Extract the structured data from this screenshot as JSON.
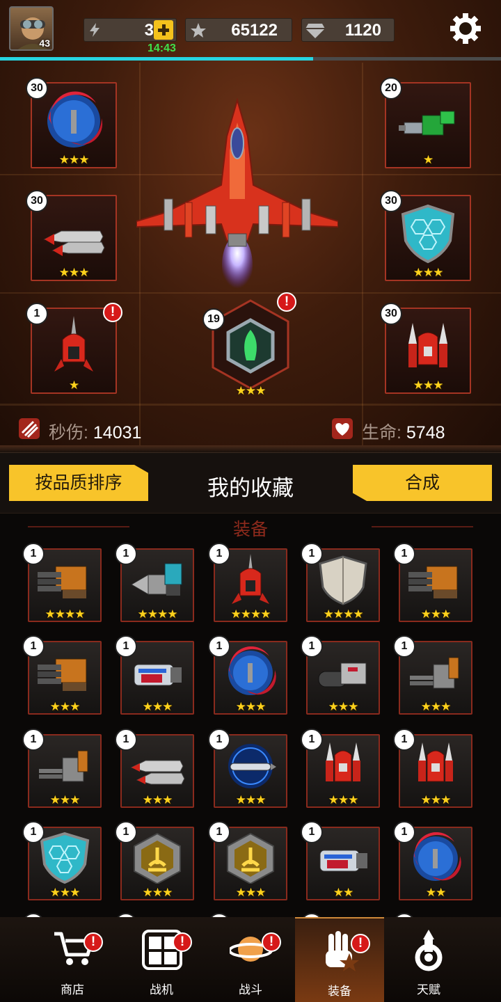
{
  "player": {
    "level": "43"
  },
  "resources": {
    "energy": "3",
    "energy_timer": "14:43",
    "stars": "65122",
    "gems": "1120"
  },
  "xp_progress": 0.625,
  "loadout": {
    "slots": [
      {
        "level": "30",
        "stars": "★★★",
        "item": "crescent-blade"
      },
      {
        "level": "20",
        "stars": "★",
        "item": "green-drill-cannon"
      },
      {
        "level": "30",
        "stars": "★★★",
        "item": "twin-missile-pod"
      },
      {
        "level": "30",
        "stars": "★★★",
        "item": "hex-shield"
      },
      {
        "level": "1",
        "stars": "★",
        "item": "red-drone",
        "alert": "!"
      },
      {
        "level": "30",
        "stars": "★★★",
        "item": "red-twin-drone"
      }
    ],
    "core": {
      "level": "19",
      "stars": "★★★",
      "alert": "!"
    }
  },
  "stats": {
    "dps_label": "秒伤:",
    "dps_value": "14031",
    "hp_label": "生命:",
    "hp_value": "5748"
  },
  "collection": {
    "sort_button": "按品质排序",
    "title": "我的收藏",
    "merge_button": "合成",
    "section": "装备"
  },
  "inventory": [
    {
      "level": "1",
      "stars": "★★★★",
      "item": "gatling"
    },
    {
      "level": "1",
      "stars": "★★★★",
      "item": "drill"
    },
    {
      "level": "1",
      "stars": "★★★★",
      "item": "red-drone"
    },
    {
      "level": "1",
      "stars": "★★★★",
      "item": "steel-shield"
    },
    {
      "level": "1",
      "stars": "★★★",
      "item": "gatling"
    },
    {
      "level": "1",
      "stars": "★★★",
      "item": "gatling"
    },
    {
      "level": "1",
      "stars": "★★★",
      "item": "plasma-cannon"
    },
    {
      "level": "1",
      "stars": "★★★",
      "item": "crescent-blade"
    },
    {
      "level": "1",
      "stars": "★★★",
      "item": "barrel-cannon"
    },
    {
      "level": "1",
      "stars": "★★★",
      "item": "rail-gun"
    },
    {
      "level": "1",
      "stars": "★★★",
      "item": "rail-gun"
    },
    {
      "level": "1",
      "stars": "★★★",
      "item": "twin-missile-pod"
    },
    {
      "level": "1",
      "stars": "★★★",
      "item": "electric-missile"
    },
    {
      "level": "1",
      "stars": "★★★",
      "item": "red-twin-drone"
    },
    {
      "level": "1",
      "stars": "★★★",
      "item": "red-twin-drone"
    },
    {
      "level": "1",
      "stars": "★★★",
      "item": "hex-shield"
    },
    {
      "level": "1",
      "stars": "★★★",
      "item": "gold-core"
    },
    {
      "level": "1",
      "stars": "★★★",
      "item": "gold-core"
    },
    {
      "level": "1",
      "stars": "★★",
      "item": "plasma-cannon"
    },
    {
      "level": "1",
      "stars": "★★",
      "item": "crescent-blade"
    }
  ],
  "nav": [
    {
      "label": "商店",
      "icon": "cart-icon",
      "alert": "!",
      "active": false
    },
    {
      "label": "战机",
      "icon": "hangar-icon",
      "alert": "!",
      "active": false
    },
    {
      "label": "战斗",
      "icon": "planet-icon",
      "alert": "!",
      "active": false
    },
    {
      "label": "装备",
      "icon": "gear-hand-icon",
      "alert": "!",
      "active": true
    },
    {
      "label": "天赋",
      "icon": "talent-icon",
      "alert": "",
      "active": false
    }
  ],
  "colors": {
    "accent": "#f8c42a",
    "frame": "#a53423",
    "xp": "#27d4e0",
    "star": "#ffd21c",
    "alert": "#d61919"
  }
}
